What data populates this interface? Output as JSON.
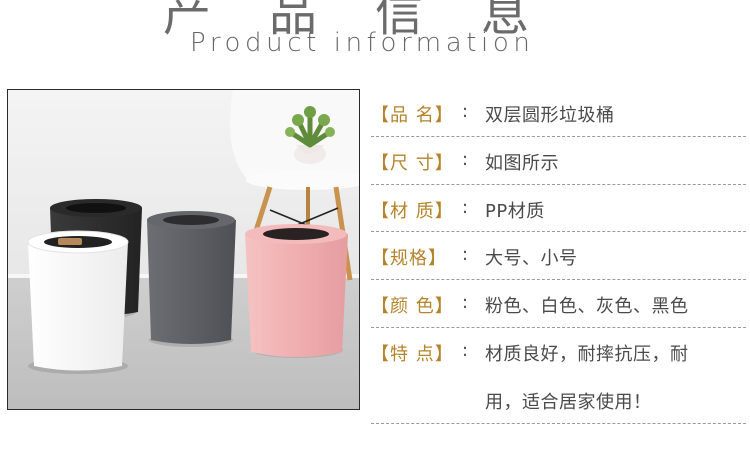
{
  "header": {
    "title_zh": "产品信息",
    "title_en": "Product information"
  },
  "specs": [
    {
      "label": "【品  名】",
      "value": "双层圆形垃圾桶"
    },
    {
      "label": "【尺  寸】",
      "value": "如图所示"
    },
    {
      "label": "【材  质】",
      "value": "PP材质"
    },
    {
      "label": "【规格】",
      "value": "大号、小号"
    },
    {
      "label": "【颜  色】",
      "value": "粉色、白色、灰色、黑色"
    },
    {
      "label": "【特  点】",
      "value": "材质良好，耐摔抗压，耐",
      "value_line2": "用，适合居家使用！"
    }
  ],
  "colon": ":",
  "colors": {
    "label": "#b4842a",
    "bin_black": "#2e2e2e",
    "bin_gray": "#5f6066",
    "bin_white": "#f7f7f7",
    "bin_pink": "#f2b3b4"
  }
}
